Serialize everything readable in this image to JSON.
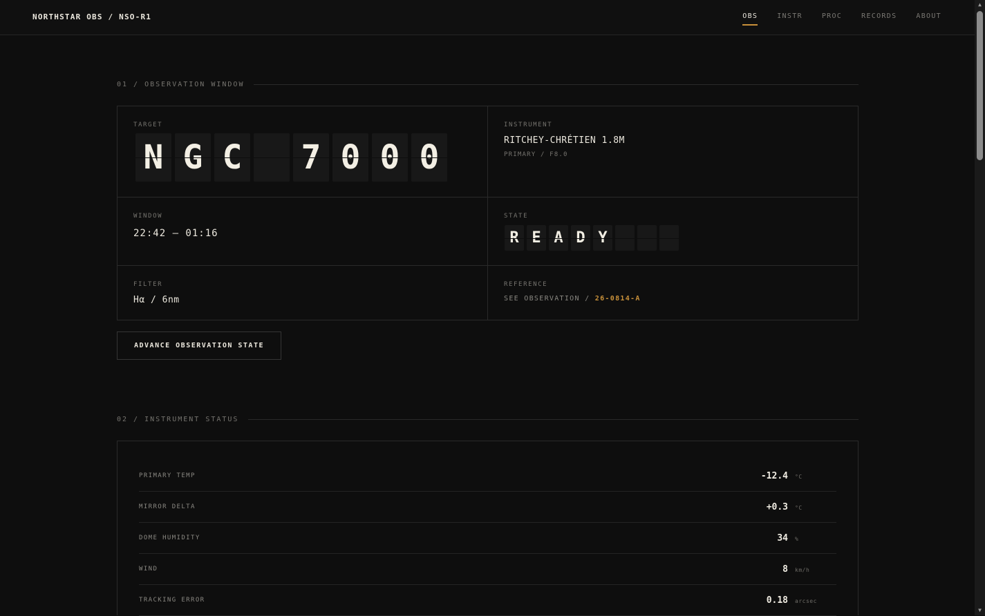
{
  "header": {
    "brand": "NORTHSTAR OBS / NSO-R1",
    "nav": [
      {
        "label": "OBS",
        "active": true
      },
      {
        "label": "INSTR",
        "active": false
      },
      {
        "label": "PROC",
        "active": false
      },
      {
        "label": "RECORDS",
        "active": false
      },
      {
        "label": "ABOUT",
        "active": false
      }
    ]
  },
  "observation": {
    "section_label": "01 / OBSERVATION WINDOW",
    "target_label": "TARGET",
    "target_flaps": [
      "N",
      "G",
      "C",
      "",
      "7",
      "0",
      "0",
      "0"
    ],
    "instrument_label": "INSTRUMENT",
    "instrument_value": "RITCHEY-CHRÉTIEN 1.8M",
    "instrument_sub": "PRIMARY / F8.0",
    "window_label": "WINDOW",
    "window_value": "22:42 – 01:16",
    "state_label": "STATE",
    "state_flaps": [
      "R",
      "E",
      "A",
      "D",
      "Y",
      "",
      "",
      ""
    ],
    "filter_label": "FILTER",
    "filter_value": "Hα / 6nm",
    "reference_label": "REFERENCE",
    "reference_prefix": "SEE OBSERVATION / ",
    "reference_code": "26-0814-A",
    "advance_button": "ADVANCE OBSERVATION STATE"
  },
  "instrument_status": {
    "section_label": "02 / INSTRUMENT STATUS",
    "rows": [
      {
        "name": "PRIMARY TEMP",
        "value": "-12.4",
        "unit": "°C"
      },
      {
        "name": "MIRROR DELTA",
        "value": "+0.3",
        "unit": "°C"
      },
      {
        "name": "DOME HUMIDITY",
        "value": "34",
        "unit": "%"
      },
      {
        "name": "WIND",
        "value": "8",
        "unit": "km/h"
      },
      {
        "name": "TRACKING ERROR",
        "value": "0.18",
        "unit": "arcsec"
      }
    ]
  },
  "colors": {
    "background": "#0e0e0e",
    "accent": "#c9913a",
    "text": "#ece8de",
    "muted": "#76746f"
  }
}
